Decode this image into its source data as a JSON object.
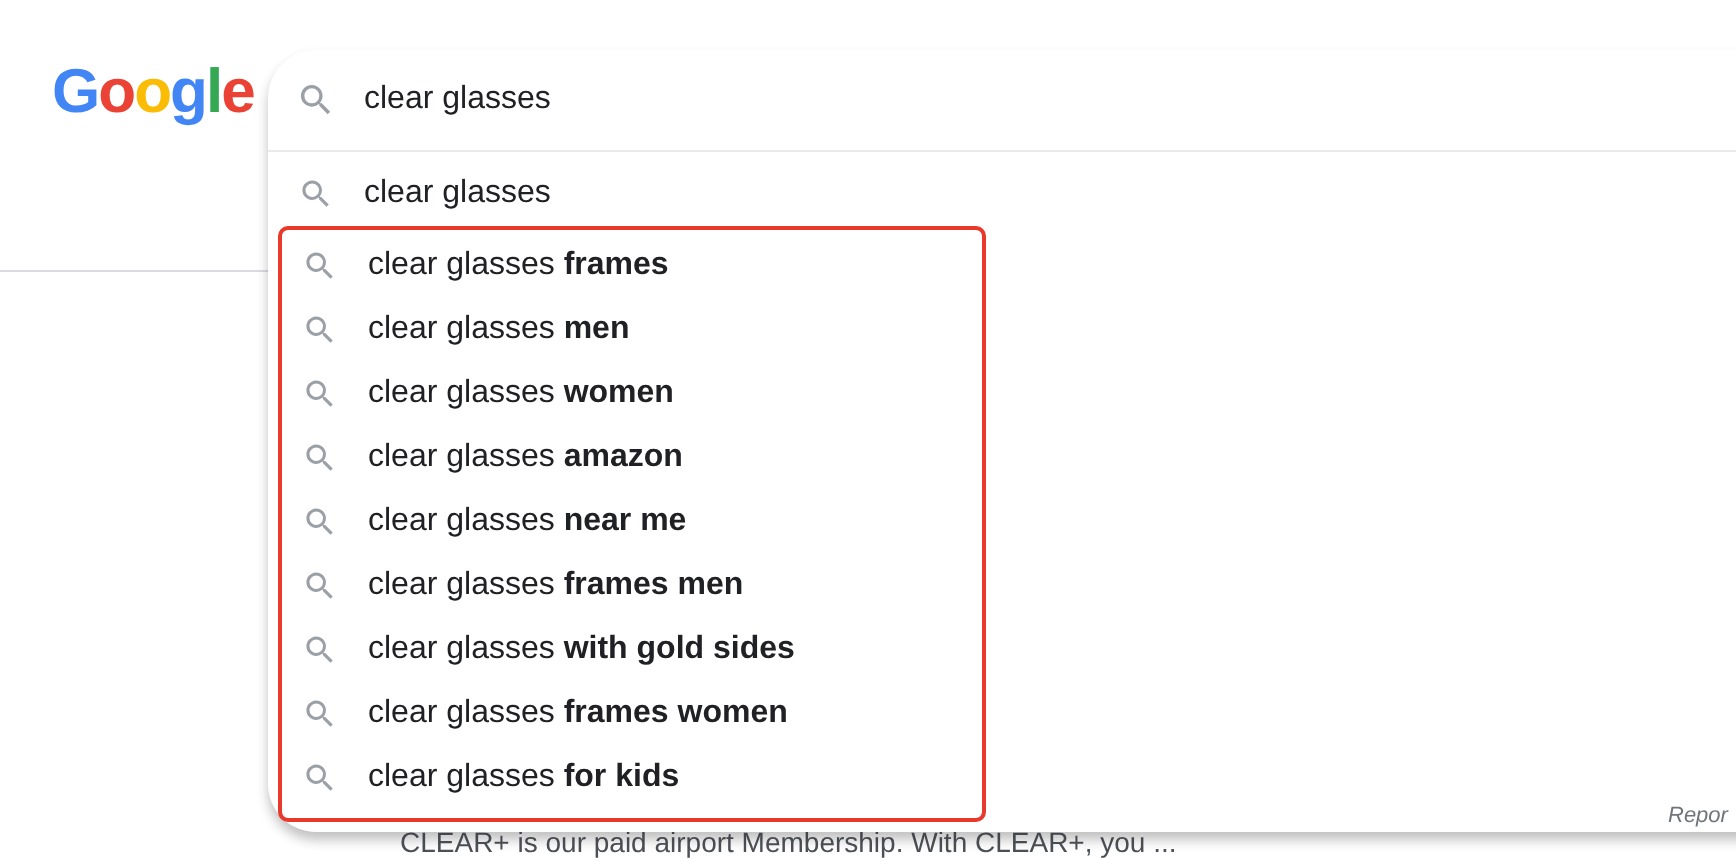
{
  "logo": "Google",
  "search": {
    "value": "clear glasses"
  },
  "suggestions": [
    {
      "text": "clear glasses",
      "highlighted": false
    },
    {
      "text": "clear glasses **frames**",
      "highlighted": true
    },
    {
      "text": "clear glasses **men**",
      "highlighted": true
    },
    {
      "text": "clear glasses **women**",
      "highlighted": true
    },
    {
      "text": "clear glasses **amazon**",
      "highlighted": true
    },
    {
      "text": "clear glasses **near me**",
      "highlighted": true
    },
    {
      "text": "clear glasses **frames men**",
      "highlighted": true
    },
    {
      "text": "clear glasses **with gold sides**",
      "highlighted": true
    },
    {
      "text": "clear glasses **frames women**",
      "highlighted": true
    },
    {
      "text": "clear glasses **for kids**",
      "highlighted": true
    }
  ],
  "report_link": "Repor",
  "result_snippet": "CLEAR+ is our paid airport Membership. With CLEAR+, you ..."
}
